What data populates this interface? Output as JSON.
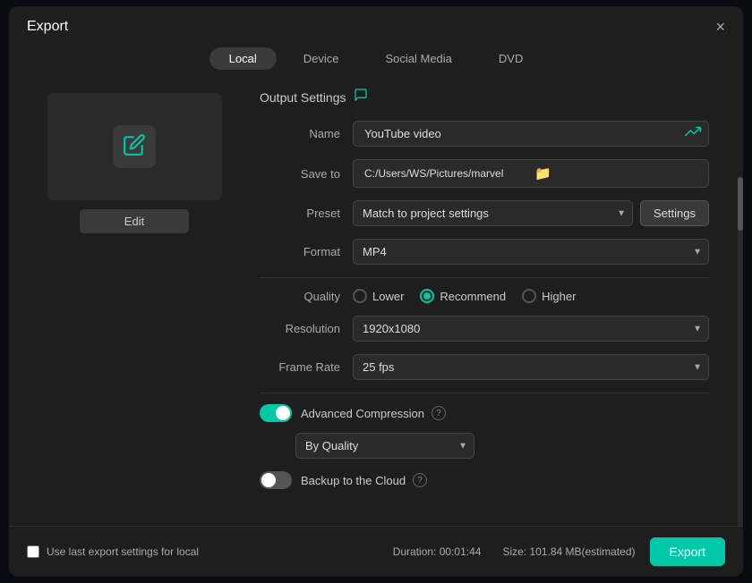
{
  "modal": {
    "title": "Export",
    "close_label": "×"
  },
  "tabs": {
    "items": [
      {
        "id": "local",
        "label": "Local",
        "active": true
      },
      {
        "id": "device",
        "label": "Device",
        "active": false
      },
      {
        "id": "social-media",
        "label": "Social Media",
        "active": false
      },
      {
        "id": "dvd",
        "label": "DVD",
        "active": false
      }
    ]
  },
  "preview": {
    "edit_label": "Edit"
  },
  "output_settings": {
    "header": "Output Settings",
    "fields": {
      "name_label": "Name",
      "name_value": "YouTube video",
      "save_to_label": "Save to",
      "save_to_value": "C:/Users/WS/Pictures/marvel",
      "preset_label": "Preset",
      "preset_value": "Match to project settings",
      "settings_label": "Settings",
      "format_label": "Format",
      "format_value": "MP4",
      "quality_label": "Quality",
      "quality_lower": "Lower",
      "quality_recommend": "Recommend",
      "quality_higher": "Higher",
      "resolution_label": "Resolution",
      "resolution_value": "1920x1080",
      "frame_rate_label": "Frame Rate",
      "frame_rate_value": "25 fps"
    },
    "advanced_compression": {
      "label": "Advanced Compression",
      "enabled": true,
      "by_quality_value": "By Quality"
    },
    "backup_cloud": {
      "label": "Backup to the Cloud",
      "enabled": false
    }
  },
  "footer": {
    "use_last_label": "Use last export settings for local",
    "duration_label": "Duration: 00:01:44",
    "size_label": "Size: 101.84 MB(estimated)",
    "export_label": "Export"
  }
}
